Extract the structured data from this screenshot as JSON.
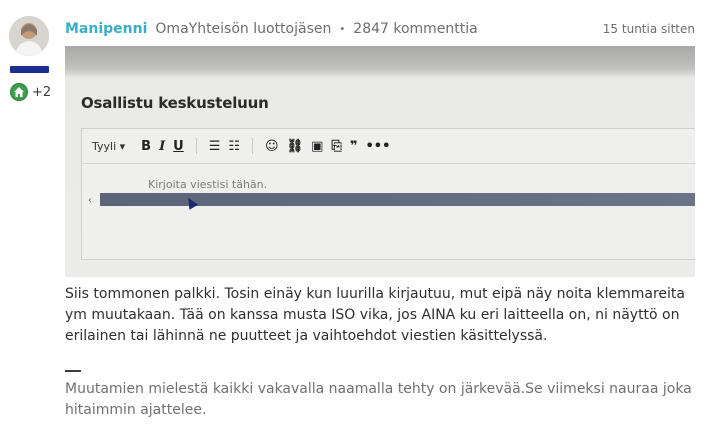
{
  "author": {
    "name": "Manipenni",
    "rank": "OmaYhteisön luottojäsen",
    "separator": "•",
    "comment_count": "2847 kommenttia",
    "badge_count": "+2",
    "avatar_icon": "user-avatar",
    "badge_icon": "home-icon",
    "rank_bar_color": "#1c2f8f",
    "badge_color": "#3aa04a"
  },
  "post": {
    "timestamp": "15 tuntia sitten",
    "body": "Siis tommonen palkki. Tosin einäy kun luurilla kirjautuu, mut eipä näy noita klemmareita ym muutakaan. Tää on kanssa musta ISO vika, jos AINA ku eri laitteella on, ni näyttö on erilainen tai lähinnä ne puutteet ja vaihtoehdot viestien käsittelyssä.",
    "signature": "Muutamien mielestä kaikki vakavalla naamalla tehty on järkevää.Se viimeksi nauraa joka hitaimmin ajattelee."
  },
  "attachment": {
    "title": "Osallistu keskusteluun",
    "toolbar": {
      "style_label": "Tyyli ▾",
      "bold": "B",
      "italic": "I",
      "underline": "U",
      "bullets": "☰",
      "numbered": "☷",
      "emoji": "☺",
      "link": "⛓",
      "image": "▣",
      "attach": "⎘",
      "quote": "❞",
      "more": "•••"
    },
    "placeholder": "Kirjoita viestisi tähän.",
    "arrow": "‹"
  }
}
